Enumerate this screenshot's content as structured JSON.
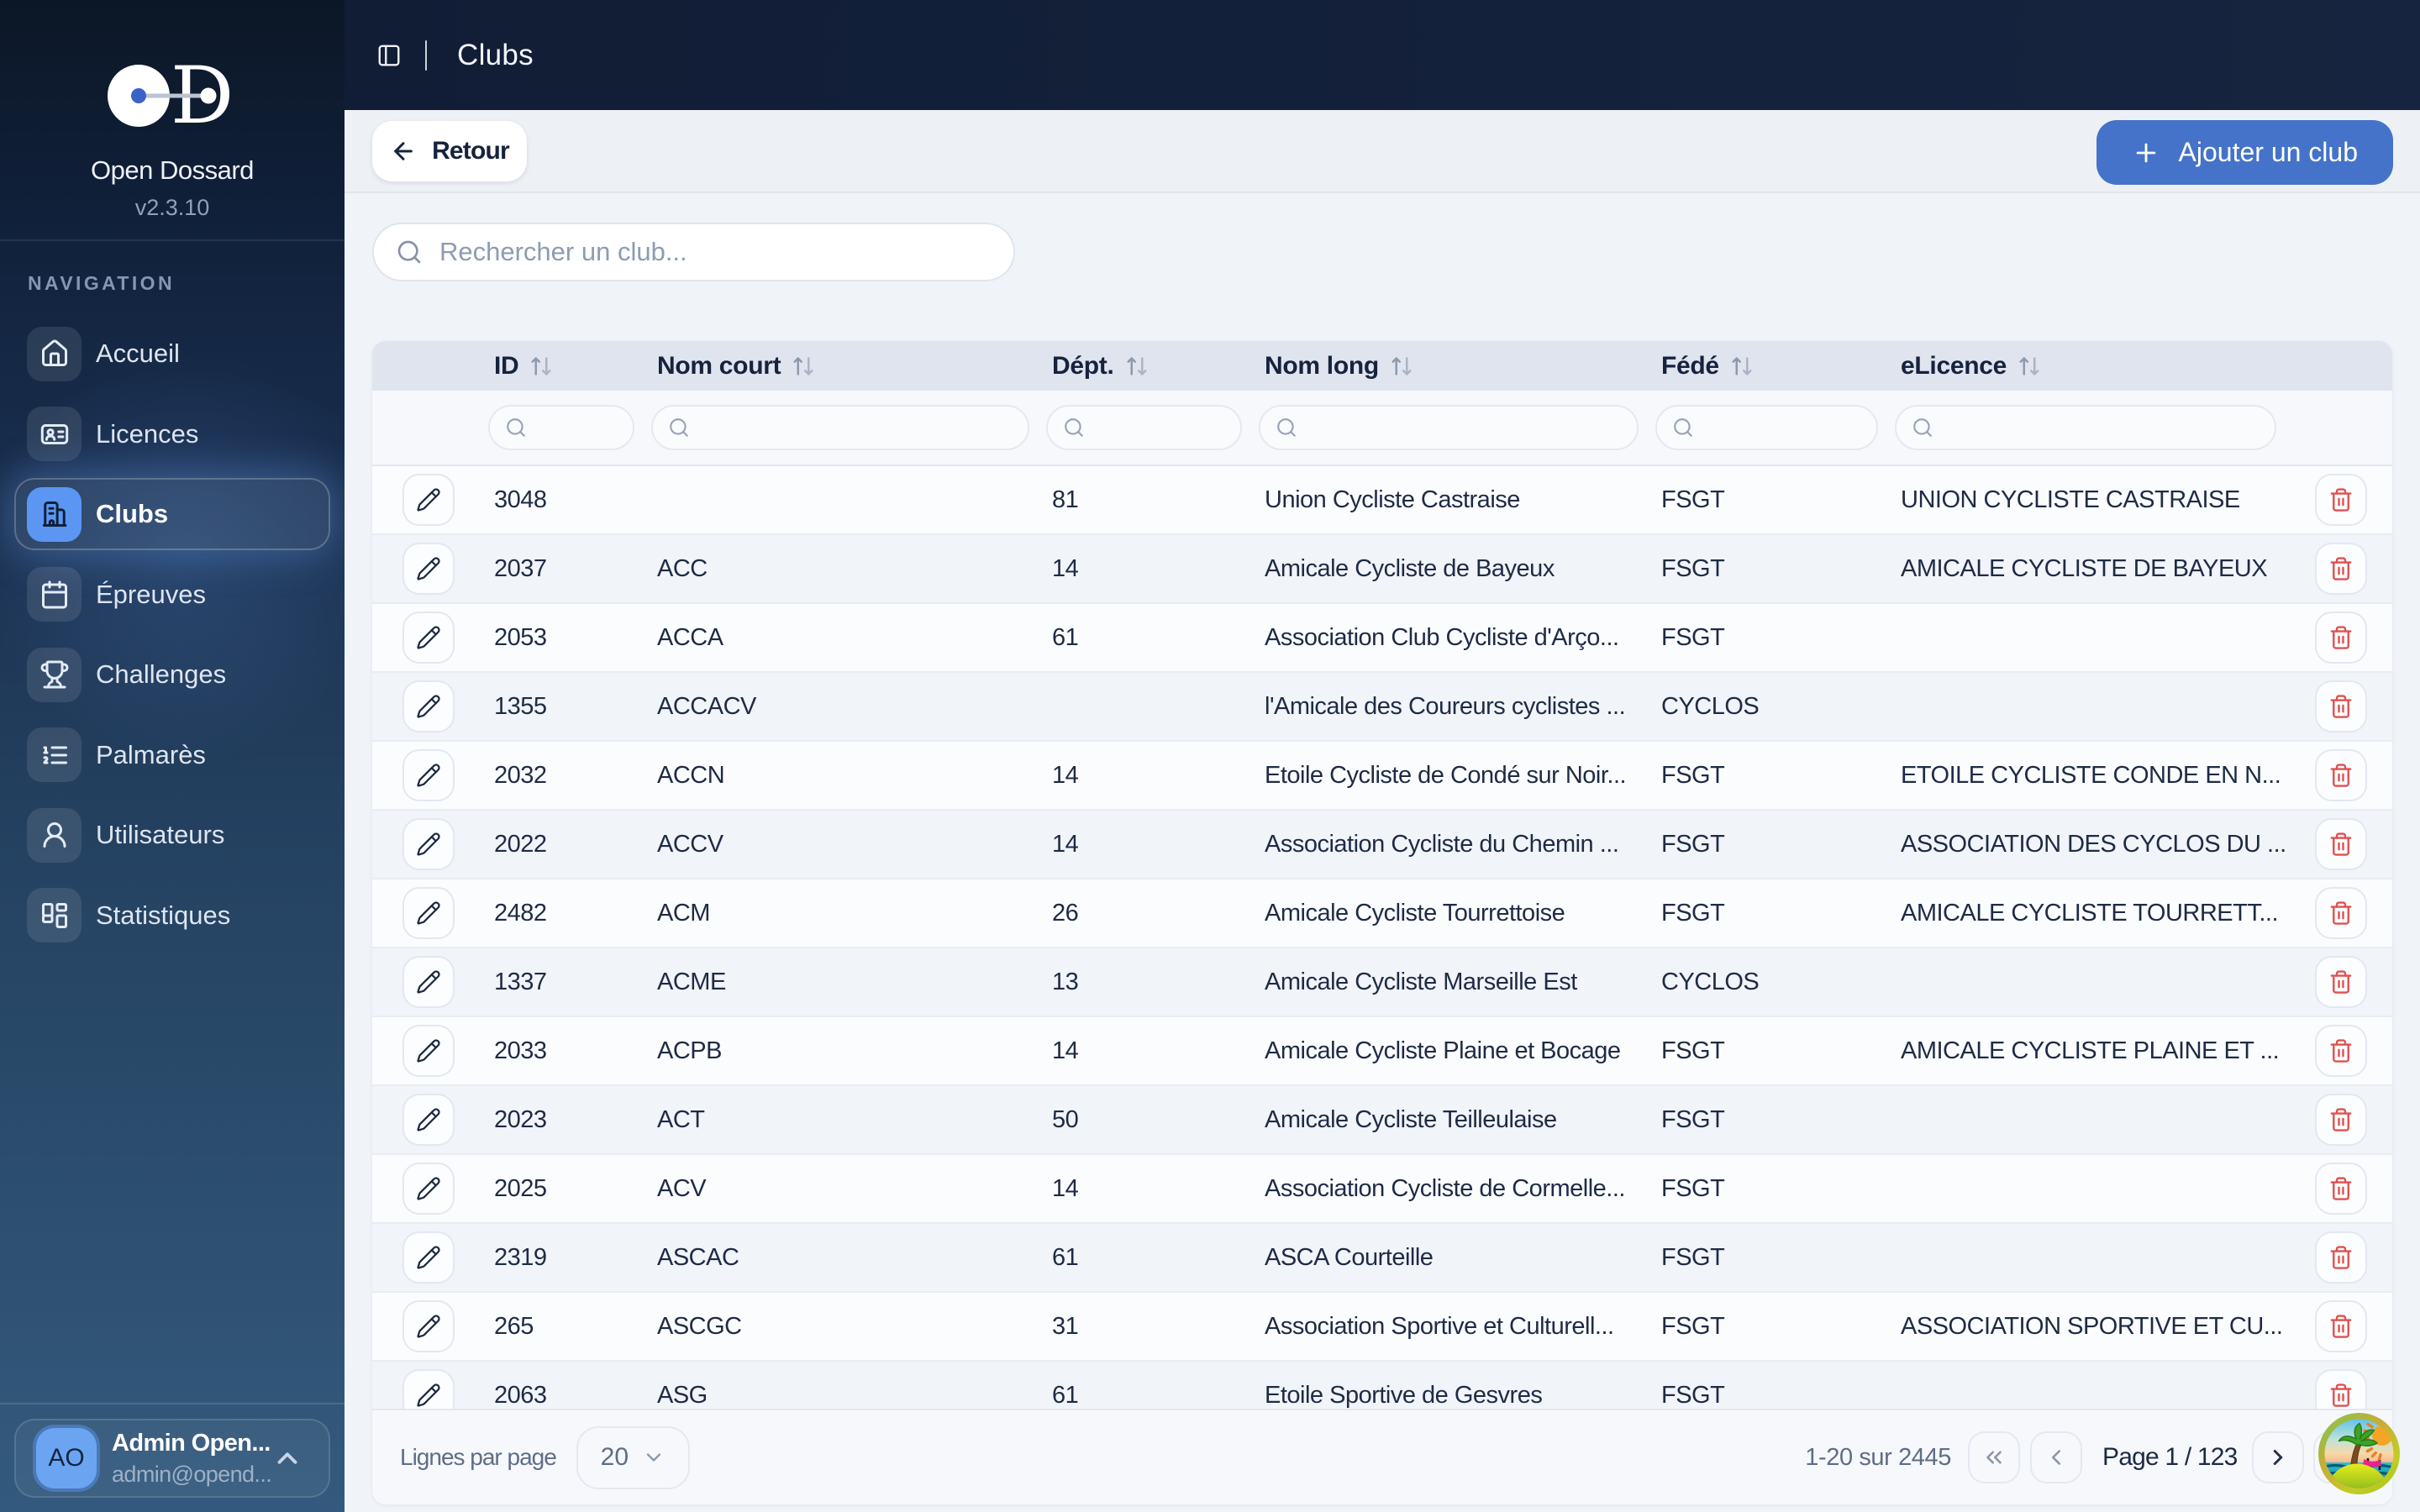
{
  "app": {
    "name": "Open Dossard",
    "version": "v2.3.10"
  },
  "topbar": {
    "title": "Clubs"
  },
  "sidebar": {
    "section_label": "NAVIGATION",
    "items": [
      {
        "label": "Accueil",
        "icon": "house",
        "active": false
      },
      {
        "label": "Licences",
        "icon": "id-card",
        "active": false
      },
      {
        "label": "Clubs",
        "icon": "building",
        "active": true
      },
      {
        "label": "Épreuves",
        "icon": "calendar",
        "active": false
      },
      {
        "label": "Challenges",
        "icon": "trophy",
        "active": false
      },
      {
        "label": "Palmarès",
        "icon": "list-ordered",
        "active": false
      },
      {
        "label": "Utilisateurs",
        "icon": "user-round",
        "active": false
      },
      {
        "label": "Statistiques",
        "icon": "layout-dashboard",
        "active": false
      }
    ],
    "user": {
      "initials": "AO",
      "name": "Admin Open...",
      "email": "admin@opend..."
    }
  },
  "actions": {
    "back_label": "Retour",
    "add_label": "Ajouter un club"
  },
  "search": {
    "placeholder": "Rechercher un club..."
  },
  "table": {
    "columns": [
      {
        "key": "id",
        "label": "ID",
        "sortable": true
      },
      {
        "key": "nom_court",
        "label": "Nom court",
        "sortable": true
      },
      {
        "key": "dept",
        "label": "Dépt.",
        "sortable": true
      },
      {
        "key": "nom_long",
        "label": "Nom long",
        "sortable": true
      },
      {
        "key": "fede",
        "label": "Fédé",
        "sortable": true
      },
      {
        "key": "elicence",
        "label": "eLicence",
        "sortable": true
      }
    ],
    "rows": [
      {
        "id": "3048",
        "nom_court": "",
        "dept": "81",
        "nom_long": "Union Cycliste Castraise",
        "fede": "FSGT",
        "elicence": "UNION CYCLISTE CASTRAISE"
      },
      {
        "id": "2037",
        "nom_court": "ACC",
        "dept": "14",
        "nom_long": "Amicale Cycliste de Bayeux",
        "fede": "FSGT",
        "elicence": "AMICALE CYCLISTE DE BAYEUX"
      },
      {
        "id": "2053",
        "nom_court": "ACCA",
        "dept": "61",
        "nom_long": "Association Club Cycliste d'Arço...",
        "fede": "FSGT",
        "elicence": ""
      },
      {
        "id": "1355",
        "nom_court": "ACCACV",
        "dept": "",
        "nom_long": "l'Amicale des Coureurs cyclistes ...",
        "fede": "CYCLOS",
        "elicence": ""
      },
      {
        "id": "2032",
        "nom_court": "ACCN",
        "dept": "14",
        "nom_long": "Etoile Cycliste de Condé sur Noir...",
        "fede": "FSGT",
        "elicence": "ETOILE CYCLISTE CONDE EN N..."
      },
      {
        "id": "2022",
        "nom_court": "ACCV",
        "dept": "14",
        "nom_long": "Association Cycliste du Chemin ...",
        "fede": "FSGT",
        "elicence": "ASSOCIATION DES CYCLOS DU ..."
      },
      {
        "id": "2482",
        "nom_court": "ACM",
        "dept": "26",
        "nom_long": "Amicale Cycliste Tourrettoise",
        "fede": "FSGT",
        "elicence": "AMICALE CYCLISTE TOURRETT..."
      },
      {
        "id": "1337",
        "nom_court": "ACME",
        "dept": "13",
        "nom_long": "Amicale Cycliste Marseille Est",
        "fede": "CYCLOS",
        "elicence": ""
      },
      {
        "id": "2033",
        "nom_court": "ACPB",
        "dept": "14",
        "nom_long": "Amicale Cycliste Plaine et Bocage",
        "fede": "FSGT",
        "elicence": "AMICALE CYCLISTE PLAINE ET ..."
      },
      {
        "id": "2023",
        "nom_court": "ACT",
        "dept": "50",
        "nom_long": "Amicale Cycliste Teilleulaise",
        "fede": "FSGT",
        "elicence": ""
      },
      {
        "id": "2025",
        "nom_court": "ACV",
        "dept": "14",
        "nom_long": "Association Cycliste de Cormelle...",
        "fede": "FSGT",
        "elicence": ""
      },
      {
        "id": "2319",
        "nom_court": "ASCAC",
        "dept": "61",
        "nom_long": "ASCA Courteille",
        "fede": "FSGT",
        "elicence": ""
      },
      {
        "id": "265",
        "nom_court": "ASCGC",
        "dept": "31",
        "nom_long": "Association Sportive et Culturell...",
        "fede": "FSGT",
        "elicence": "ASSOCIATION SPORTIVE ET CU..."
      },
      {
        "id": "2063",
        "nom_court": "ASG",
        "dept": "61",
        "nom_long": "Etoile Sportive de Gesvres",
        "fede": "FSGT",
        "elicence": ""
      }
    ]
  },
  "footer": {
    "rows_per_page_label": "Lignes par page",
    "rows_per_page": "20",
    "range": "1-20 sur 2445",
    "page": "Page 1 / 123"
  },
  "colors": {
    "accent_blue": "#4473c9",
    "tile_blue": "#5b97f2",
    "sidebar_top": "#0c1726",
    "sidebar_bottom": "#335a7e",
    "danger": "#e0504e"
  }
}
